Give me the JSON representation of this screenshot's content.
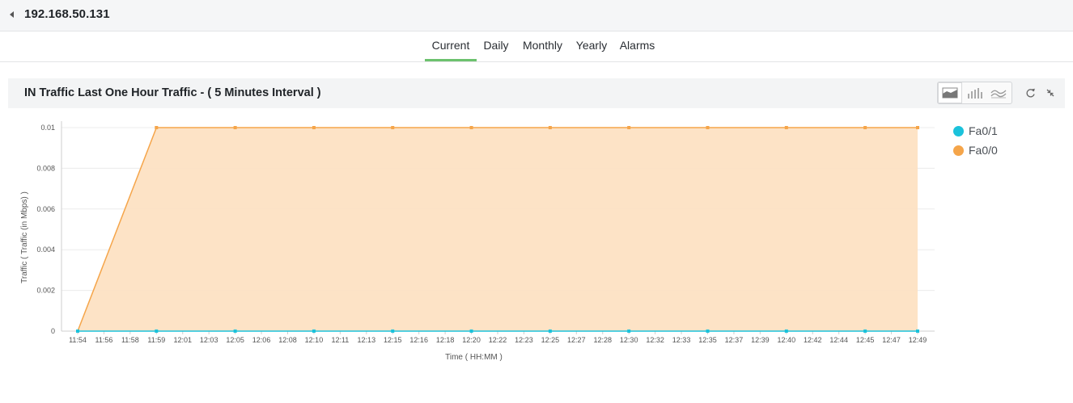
{
  "header": {
    "title": "192.168.50.131",
    "back_icon": "back-arrow-icon"
  },
  "tabs": [
    {
      "label": "Current",
      "active": true
    },
    {
      "label": "Daily",
      "active": false
    },
    {
      "label": "Monthly",
      "active": false
    },
    {
      "label": "Yearly",
      "active": false
    },
    {
      "label": "Alarms",
      "active": false
    }
  ],
  "panel": {
    "title": "IN Traffic Last One Hour Traffic - ( 5 Minutes Interval )",
    "chart_type_buttons": [
      "area-chart-icon",
      "bar-chart-icon",
      "line-chart-icon"
    ],
    "actions": [
      "refresh-icon",
      "collapse-icon"
    ]
  },
  "colors": {
    "accent": "#6cc26e",
    "fa00": "#f5a54a",
    "fa01": "#1bc2db"
  },
  "chart_data": {
    "type": "area",
    "xlabel": "Time ( HH:MM )",
    "ylabel": "Traffic ( Traffic (in Mbps) )",
    "ylim": [
      0,
      0.01
    ],
    "yticks": [
      "0",
      "0.002",
      "0.004",
      "0.006",
      "0.008",
      "0.01"
    ],
    "categories": [
      "11:54",
      "11:56",
      "11:58",
      "11:59",
      "12:01",
      "12:03",
      "12:05",
      "12:06",
      "12:08",
      "12:10",
      "12:11",
      "12:13",
      "12:15",
      "12:16",
      "12:18",
      "12:20",
      "12:22",
      "12:23",
      "12:25",
      "12:27",
      "12:28",
      "12:30",
      "12:32",
      "12:33",
      "12:35",
      "12:37",
      "12:39",
      "12:40",
      "12:42",
      "12:44",
      "12:45",
      "12:47",
      "12:49"
    ],
    "grid": true,
    "legend_position": "right",
    "series": [
      {
        "name": "Fa0/1",
        "color": "#1bc2db",
        "points": [
          [
            "11:54",
            0
          ],
          [
            "11:59",
            0
          ],
          [
            "12:05",
            0
          ],
          [
            "12:10",
            0
          ],
          [
            "12:15",
            0
          ],
          [
            "12:20",
            0
          ],
          [
            "12:25",
            0
          ],
          [
            "12:30",
            0
          ],
          [
            "12:35",
            0
          ],
          [
            "12:40",
            0
          ],
          [
            "12:45",
            0
          ],
          [
            "12:49",
            0
          ]
        ]
      },
      {
        "name": "Fa0/0",
        "color": "#f5a54a",
        "points": [
          [
            "11:54",
            0
          ],
          [
            "11:59",
            0.01
          ],
          [
            "12:05",
            0.01
          ],
          [
            "12:10",
            0.01
          ],
          [
            "12:15",
            0.01
          ],
          [
            "12:20",
            0.01
          ],
          [
            "12:25",
            0.01
          ],
          [
            "12:30",
            0.01
          ],
          [
            "12:35",
            0.01
          ],
          [
            "12:40",
            0.01
          ],
          [
            "12:45",
            0.01
          ],
          [
            "12:49",
            0.01
          ]
        ]
      }
    ]
  }
}
